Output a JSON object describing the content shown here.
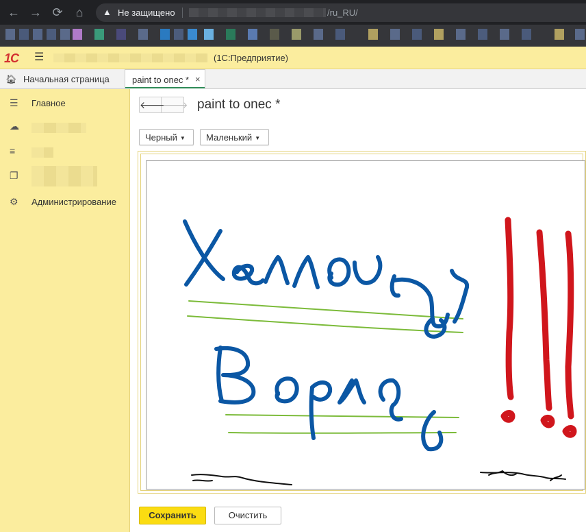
{
  "browser": {
    "insecure_label": "Не защищено",
    "url_path": "/ru_RU/"
  },
  "app": {
    "logo": "1С",
    "name": "(1С:Предприятие)"
  },
  "tabs": {
    "home": "Начальная страница",
    "active": "paint to onec *",
    "close": "×"
  },
  "sidebar": {
    "items": [
      {
        "label": "Главное",
        "icon": "list-icon"
      },
      {
        "label": "",
        "icon": "cloud-icon"
      },
      {
        "label": "",
        "icon": "document-lines-icon"
      },
      {
        "label": "",
        "icon": "copy-documents-icon"
      },
      {
        "label": "Администрирование",
        "icon": "gear-icon"
      }
    ]
  },
  "form": {
    "title": "paint to onec *",
    "color_select": "Черный",
    "size_select": "Маленький",
    "save_label": "Сохранить",
    "clear_label": "Очистить"
  },
  "colors": {
    "accent_yellow": "#fbed9e",
    "save_button": "#fbdc12",
    "stroke_blue": "#0b57a4",
    "stroke_red": "#d0161c",
    "stroke_green": "#7cbb3a",
    "stroke_black": "#111111"
  }
}
